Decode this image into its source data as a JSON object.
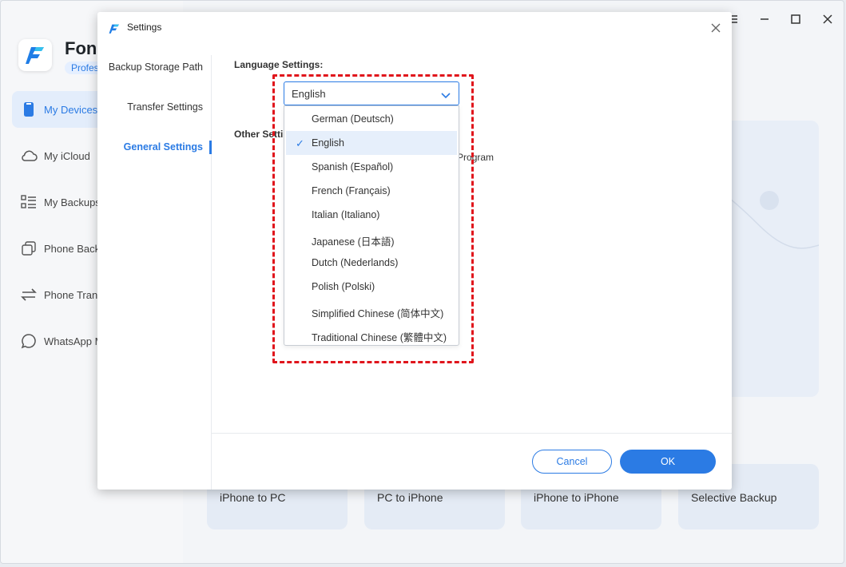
{
  "app": {
    "brand_name": "Fone",
    "brand_badge": "Profes",
    "nav": [
      {
        "label": "My Devices",
        "icon": "phone-icon",
        "active": true
      },
      {
        "label": "My iCloud",
        "icon": "cloud-icon"
      },
      {
        "label": "My Backups",
        "icon": "list-icon"
      },
      {
        "label": "Phone Backu",
        "icon": "copy-icon"
      },
      {
        "label": "Phone Trans",
        "icon": "transfer-icon"
      },
      {
        "label": "WhatsApp M",
        "icon": "chat-icon"
      }
    ],
    "tiles": [
      "iPhone to PC",
      "PC to iPhone",
      "iPhone to iPhone",
      "Selective Backup"
    ],
    "window_controls": {
      "minimize": "minimize-icon",
      "maximize": "maximize-icon",
      "close": "close-icon"
    }
  },
  "dialog": {
    "title": "Settings",
    "nav": [
      {
        "label": "Backup Storage Path"
      },
      {
        "label": "Transfer Settings"
      },
      {
        "label": "General Settings",
        "active": true
      }
    ],
    "language_heading": "Language Settings:",
    "other_heading": "Other Setti",
    "program_text": "ent Program",
    "cancel_label": "Cancel",
    "ok_label": "OK"
  },
  "language": {
    "selected": "English",
    "options": [
      "German (Deutsch)",
      "English",
      "Spanish (Español)",
      "French (Français)",
      "Italian (Italiano)",
      "Japanese (日本語)",
      "Dutch (Nederlands)",
      "Polish (Polski)",
      "Simplified Chinese (简体中文)",
      "Traditional Chinese (繁體中文)"
    ]
  },
  "colors": {
    "accent": "#2b7be4",
    "highlight": "#e0151c"
  }
}
